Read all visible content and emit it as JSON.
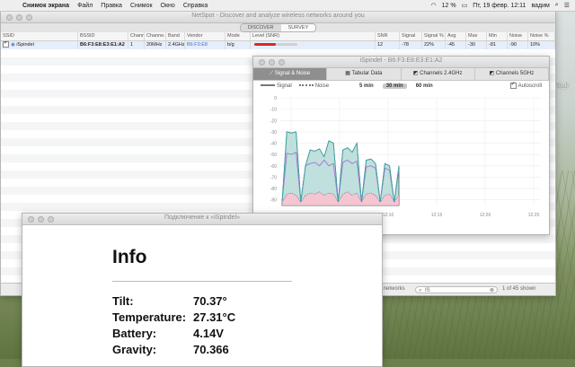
{
  "menubar": {
    "apple": "",
    "items": [
      "Снимок экрана",
      "Файл",
      "Правка",
      "Снимок",
      "Окно",
      "Справка"
    ],
    "battery": "12 %",
    "clock": "Пт, 19 февр.  12:11",
    "user": "вадим"
  },
  "desktop": {
    "icon_label": "istvo_k\nsx"
  },
  "main_window": {
    "title": "NetSpot - Discover and analyze wireless networks around you",
    "modes": [
      "DISCOVER",
      "SURVEY"
    ],
    "columns": [
      "SSID",
      "BSSID",
      "Chann...",
      "Channe...",
      "Band",
      "Vendor",
      "Mode",
      "Level (SNR)",
      "SNR",
      "Signal",
      "Signal %",
      "Avg",
      "Max",
      "Min",
      "Noise",
      "Noise %"
    ],
    "row": {
      "ssid": "iSpindel",
      "bssid": "B6:F3:E8:E3:E1:A2",
      "channel": "1",
      "width": "20MHz",
      "band": "2.4GHz",
      "vendor": "B6:F3:E8",
      "mode": "b/g",
      "snr": "12",
      "signal": "-78",
      "signal_pct": "22%",
      "avg": "-45",
      "max": "-30",
      "min": "-81",
      "noise": "-90",
      "noise_pct": "10%",
      "level_fraction": 0.5
    },
    "bottom": {
      "filter_text": "r networks",
      "search_value": "IS",
      "shown": "1 of 45 shown"
    }
  },
  "detail_window": {
    "title": "iSpindel - B6:F3:E8:E3:E1:A2",
    "tabs": [
      "Signal & Noise",
      "Tabular Data",
      "Channels 2.4GHz",
      "Channels 5GHz"
    ],
    "legend": [
      "Signal",
      "Noise"
    ],
    "ranges": [
      "5 min",
      "30 min",
      "60 min"
    ],
    "selected_range": "30 min",
    "autoscroll": "Autoscroll"
  },
  "chart_data": {
    "type": "area",
    "y_ticks": [
      "0",
      "-10",
      "-20",
      "-30",
      "-40",
      "-50",
      "-60",
      "-70",
      "-80",
      "-90"
    ],
    "x_ticks": [
      "12:00",
      "12:05",
      "12:10",
      "12:15",
      "12:20",
      "12:25"
    ],
    "ylim": [
      -95,
      0
    ],
    "series": [
      {
        "values": [
          -92,
          -30,
          -31,
          -30,
          -92,
          -60,
          -46,
          -47,
          -45,
          -52,
          -38,
          -40,
          -92,
          -46,
          -44,
          -48,
          -40,
          -92,
          -55,
          -54,
          -58,
          -92,
          -58,
          -60,
          -92,
          -60
        ]
      },
      {
        "values": [
          -92,
          -49,
          -50,
          -48,
          -92,
          -60,
          -58,
          -57,
          -60,
          -55,
          -60,
          -58,
          -92,
          -57,
          -55,
          -58,
          -56,
          -92,
          -61,
          -60,
          -62,
          -92,
          -62,
          -64,
          -92,
          -63
        ]
      },
      {
        "values": [
          -92,
          -85,
          -84,
          -86,
          -92,
          -86,
          -84,
          -85,
          -83,
          -86,
          -84,
          -85,
          -92,
          -85,
          -83,
          -86,
          -84,
          -92,
          -85,
          -84,
          -86,
          -92,
          -86,
          -85,
          -92,
          -86
        ]
      }
    ],
    "grid": true
  },
  "info_window": {
    "title": "Подключение к «iSpindel»",
    "heading": "Info",
    "rows": [
      {
        "k": "Tilt:",
        "v": "70.37°"
      },
      {
        "k": "Temperature:",
        "v": "27.31°C"
      },
      {
        "k": "Battery:",
        "v": "4.14V"
      },
      {
        "k": "Gravity:",
        "v": "70.366"
      }
    ]
  }
}
